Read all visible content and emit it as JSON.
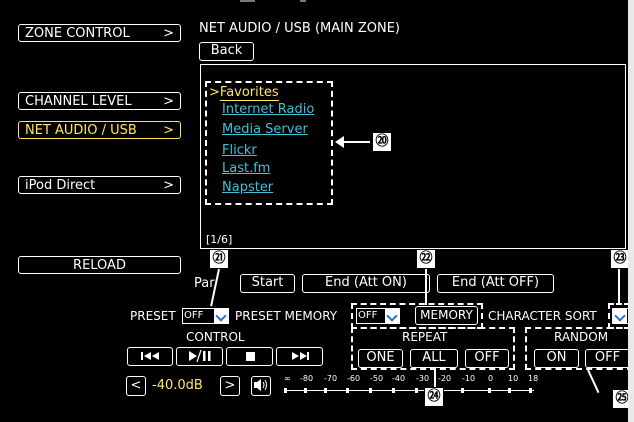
{
  "sidebar": {
    "items": [
      {
        "label": "ZONE CONTROL",
        "chevron": ">"
      },
      {
        "label": "CHANNEL LEVEL",
        "chevron": ">"
      },
      {
        "label": "NET AUDIO / USB",
        "chevron": ">"
      },
      {
        "label": "iPod Direct",
        "chevron": ">"
      }
    ],
    "active_index": 2,
    "reload_label": "RELOAD"
  },
  "header": {
    "title": "NET AUDIO / USB (MAIN ZONE)",
    "back_label": "Back"
  },
  "browser": {
    "selected_prefix": ">",
    "items": [
      "Favorites",
      "Internet Radio",
      "Media Server",
      "Flickr",
      "Last.fm",
      "Napster"
    ],
    "page_indicator": "[1/6]"
  },
  "party": {
    "label": "Par",
    "start_label": "Start",
    "end_att_on_label": "End (Att ON)",
    "end_att_off_label": "End (Att OFF)"
  },
  "preset": {
    "label": "PRESET",
    "value": "OFF",
    "memory_label": "PRESET MEMORY",
    "memory_value": "OFF",
    "memory_button": "MEMORY",
    "char_sort_label": "CHARACTER SORT"
  },
  "control": {
    "label": "CONTROL",
    "icons": [
      "skip-back-icon",
      "play-pause-icon",
      "stop-icon",
      "skip-forward-icon"
    ]
  },
  "repeat": {
    "label": "REPEAT",
    "options": [
      "ONE",
      "ALL",
      "OFF"
    ]
  },
  "random": {
    "label": "RANDOM",
    "options": [
      "ON",
      "OFF"
    ]
  },
  "volume": {
    "down_label": "<",
    "value": "-40.0dB",
    "up_label": ">",
    "mute_icon": "speaker-icon",
    "scale": [
      "∞",
      "-80",
      "-70",
      "-60",
      "-50",
      "-40",
      "-30",
      "-20",
      "-10",
      "0",
      "10",
      "18"
    ]
  },
  "callouts": [
    "⑳",
    "㉑",
    "㉒",
    "㉓",
    "㉔",
    "㉕"
  ],
  "colors": {
    "background": "#000000",
    "active": "#ffe55c",
    "link": "#3fc1d8",
    "volume": "#ffe55c"
  }
}
